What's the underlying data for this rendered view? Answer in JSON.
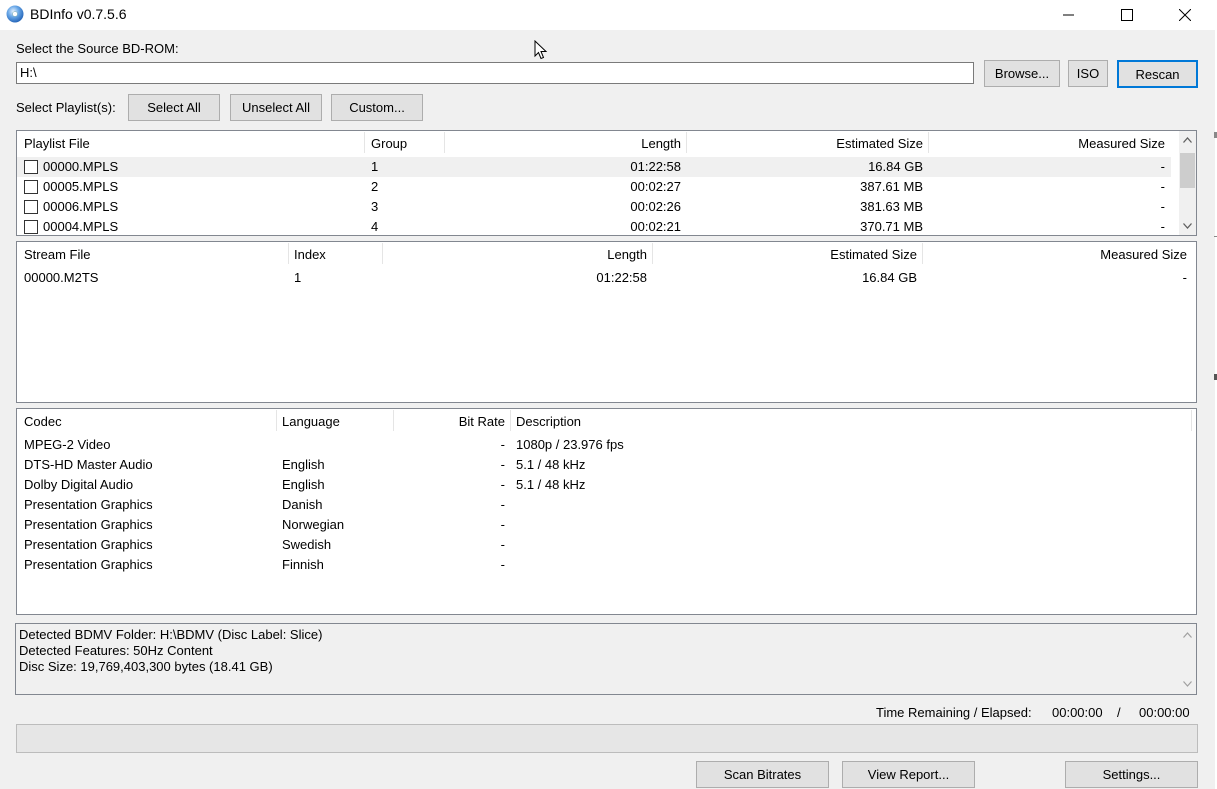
{
  "window": {
    "title": "BDInfo v0.7.5.6",
    "icon": "disc-icon",
    "controls": [
      "minimize-icon",
      "maximize-icon",
      "close-icon"
    ]
  },
  "source": {
    "label": "Select the Source BD-ROM:",
    "path": "H:\\",
    "browse_label": "Browse...",
    "iso_label": "ISO",
    "rescan_label": "Rescan"
  },
  "playlist_select": {
    "label": "Select Playlist(s):",
    "select_all_label": "Select All",
    "unselect_all_label": "Unselect All",
    "custom_label": "Custom..."
  },
  "playlists": {
    "columns": [
      "Playlist File",
      "Group",
      "Length",
      "Estimated Size",
      "Measured Size"
    ],
    "rows": [
      {
        "file": "00000.MPLS",
        "group": "1",
        "length": "01:22:58",
        "estimated": "16.84 GB",
        "measured": "-",
        "checked": false
      },
      {
        "file": "00005.MPLS",
        "group": "2",
        "length": "00:02:27",
        "estimated": "387.61 MB",
        "measured": "-",
        "checked": false
      },
      {
        "file": "00006.MPLS",
        "group": "3",
        "length": "00:02:26",
        "estimated": "381.63 MB",
        "measured": "-",
        "checked": false
      },
      {
        "file": "00004.MPLS",
        "group": "4",
        "length": "00:02:21",
        "estimated": "370.71 MB",
        "measured": "-",
        "checked": false
      }
    ]
  },
  "streams": {
    "columns": [
      "Stream File",
      "Index",
      "Length",
      "Estimated Size",
      "Measured Size"
    ],
    "rows": [
      {
        "file": "00000.M2TS",
        "index": "1",
        "length": "01:22:58",
        "estimated": "16.84 GB",
        "measured": "-"
      }
    ]
  },
  "codecs": {
    "columns": [
      "Codec",
      "Language",
      "Bit Rate",
      "Description"
    ],
    "rows": [
      {
        "codec": "MPEG-2 Video",
        "language": "",
        "bitrate": "-",
        "description": "1080p / 23.976 fps"
      },
      {
        "codec": "DTS-HD Master Audio",
        "language": "English",
        "bitrate": "-",
        "description": "5.1 / 48 kHz"
      },
      {
        "codec": "Dolby Digital Audio",
        "language": "English",
        "bitrate": "-",
        "description": "5.1 / 48 kHz"
      },
      {
        "codec": "Presentation Graphics",
        "language": "Danish",
        "bitrate": "-",
        "description": ""
      },
      {
        "codec": "Presentation Graphics",
        "language": "Norwegian",
        "bitrate": "-",
        "description": ""
      },
      {
        "codec": "Presentation Graphics",
        "language": "Swedish",
        "bitrate": "-",
        "description": ""
      },
      {
        "codec": "Presentation Graphics",
        "language": "Finnish",
        "bitrate": "-",
        "description": ""
      }
    ]
  },
  "summary": {
    "lines": [
      "Detected BDMV Folder: H:\\BDMV (Disc Label: Slice)",
      "Detected Features: 50Hz Content",
      "Disc Size: 19,769,403,300 bytes (18.41 GB)"
    ]
  },
  "progress": {
    "time_label": "Time Remaining / Elapsed:",
    "remaining": "00:00:00",
    "separator": "/",
    "elapsed": "00:00:00",
    "fraction": 0
  },
  "bottom_buttons": {
    "scan_label": "Scan Bitrates",
    "report_label": "View Report...",
    "settings_label": "Settings..."
  }
}
